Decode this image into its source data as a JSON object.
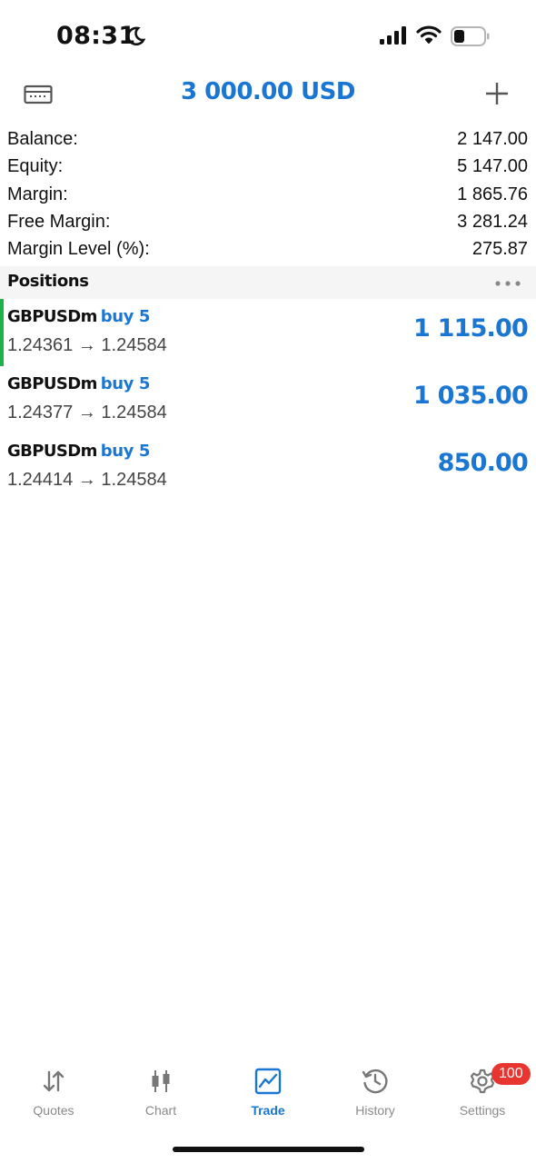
{
  "status_bar": {
    "time": "08:31",
    "icons": [
      "moon-icon",
      "cellular-signal-icon",
      "wifi-icon",
      "battery-icon"
    ]
  },
  "header": {
    "title": "3 000.00 USD",
    "left_icon": "keyboard-icon",
    "right_icon": "plus-icon"
  },
  "summary": {
    "rows": [
      {
        "label": "Balance:",
        "value": "2 147.00"
      },
      {
        "label": "Equity:",
        "value": "5 147.00"
      },
      {
        "label": "Margin:",
        "value": "1 865.76"
      },
      {
        "label": "Free Margin:",
        "value": "3 281.24"
      },
      {
        "label": "Margin Level (%):",
        "value": "275.87"
      }
    ]
  },
  "positions": {
    "title": "Positions",
    "menu_icon": "more-dots-icon",
    "items": [
      {
        "symbol": "GBPUSDm",
        "side": "buy 5",
        "prices": "1.24361 → 1.24584",
        "profit": "1 115.00"
      },
      {
        "symbol": "GBPUSDm",
        "side": "buy 5",
        "prices": "1.24377 → 1.24584",
        "profit": "1 035.00"
      },
      {
        "symbol": "GBPUSDm",
        "side": "buy 5",
        "prices": "1.24414 → 1.24584",
        "profit": "850.00"
      }
    ]
  },
  "tabbar": {
    "tabs": [
      {
        "label": "Quotes",
        "icon": "quotes-arrows-icon"
      },
      {
        "label": "Chart",
        "icon": "candlestick-chart-icon"
      },
      {
        "label": "Trade",
        "icon": "trade-line-chart-icon",
        "active": true
      },
      {
        "label": "History",
        "icon": "history-clock-icon"
      },
      {
        "label": "Settings",
        "icon": "gear-icon",
        "badge": "100"
      }
    ]
  },
  "colors": {
    "accent": "#1976d2",
    "profit_positive": "#1976d2",
    "active_position_indicator": "#1fb24a",
    "badge": "#e8352f"
  }
}
